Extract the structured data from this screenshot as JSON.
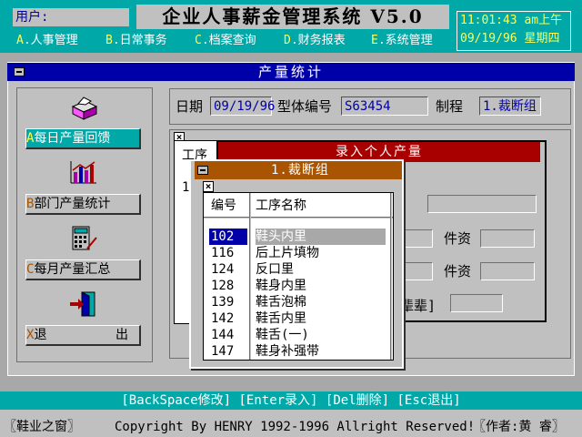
{
  "header": {
    "user_label": "用户:",
    "title": "企业人事薪金管理系统 V5.0",
    "menu": [
      {
        "key": "A",
        "label": ".人事管理"
      },
      {
        "key": "B",
        "label": ".日常事务"
      },
      {
        "key": "C",
        "label": ".档案查询"
      },
      {
        "key": "D",
        "label": ".财务报表"
      },
      {
        "key": "E",
        "label": ".系统管理"
      }
    ],
    "clock": {
      "time": "11:01:43 am上午",
      "date": "09/19/96 星期四"
    }
  },
  "window": {
    "title": "产量统计"
  },
  "left_panel": {
    "buttons": [
      {
        "key": "A",
        "label": "每日产量回馈"
      },
      {
        "key": "B",
        "label": "部门产量统计"
      },
      {
        "key": "C",
        "label": "每月产量汇总"
      },
      {
        "key": "X",
        "label": "退",
        "label2": "出"
      }
    ],
    "icons": [
      "printer-icon",
      "bar-chart-icon",
      "calculator-icon",
      "exit-door-icon"
    ]
  },
  "info": {
    "date_label": "日期",
    "date_value": "09/19/96",
    "model_label": "型体编号",
    "model_value": "S63454",
    "process_label": "制程",
    "process_value": "1.裁断组"
  },
  "records": {
    "col_label": "工序",
    "row_value": "1"
  },
  "entry": {
    "title": "录入个人产量",
    "wage_label_1": "件资",
    "wage_label_2": "件资",
    "partial_label": "辈辈]"
  },
  "process_popup": {
    "title": "1.裁断组",
    "col_code": "编号",
    "col_name": "工序名称",
    "rows": [
      {
        "code": "102",
        "name": "鞋头内里"
      },
      {
        "code": "116",
        "name": "后上片填物"
      },
      {
        "code": "124",
        "name": "反口里"
      },
      {
        "code": "128",
        "name": "鞋身内里"
      },
      {
        "code": "139",
        "name": "鞋舌泡棉"
      },
      {
        "code": "142",
        "name": "鞋舌内里"
      },
      {
        "code": "144",
        "name": "鞋舌(一)"
      },
      {
        "code": "147",
        "name": "鞋身补强带"
      }
    ]
  },
  "hint": "[BackSpace修改] [Enter录入] [Del删除] [Esc退出]",
  "footer": {
    "left": "〖鞋业之窗〗",
    "center": "Copyright By HENRY 1992-1996 Allright Reserved!",
    "right": "〖作者:黄 睿〗"
  },
  "colors": {
    "cyan": "#00a8a8",
    "navy": "#0000a8",
    "red": "#a80000",
    "brown": "#a85400",
    "gray": "#c0c0c0"
  }
}
